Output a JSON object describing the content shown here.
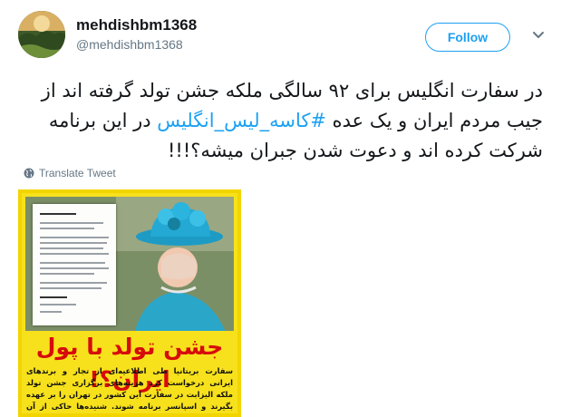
{
  "author": {
    "display_name": "mehdishbm1368",
    "handle": "@mehdishbm1368"
  },
  "follow_label": "Follow",
  "tweet": {
    "part1": "در سفارت انگلیس برای ۹۲ سالگی ملکه جشن تولد گرفته اند از جیب مردم ایران و یک عده ",
    "hashtag": "#کاسه_لیس_انگلیس",
    "part2": " در این برنامه شرکت کرده اند و دعوت شدن جبران میشه؟!!!"
  },
  "translate_label": "Translate Tweet",
  "media": {
    "headline": "جشن تولد با پول ایران؟!",
    "caption": "سفارت بریتانیا طی اطلاعیه‌ای از تجار و برندهای ایرانی درخواست کرد هزینه‌های برگزاری جشن تولد ملکه الیزابت در سفارت این کشور در تهران را بر عهده بگیرند و اسپانسر برنامه شوند. شنیده‌ها حاکی از آن است که تعدادی از مسئولین بخش خصوصی و دولتی قرار است در این جشن شرکت کنند."
  },
  "colors": {
    "accent": "#1da1f2",
    "text": "#14171a",
    "secondary": "#657786",
    "media_background": "#f7e11c",
    "headline_red": "#d60b0b"
  },
  "icons": [
    "avatar",
    "chevron-down-icon",
    "globe-icon"
  ]
}
